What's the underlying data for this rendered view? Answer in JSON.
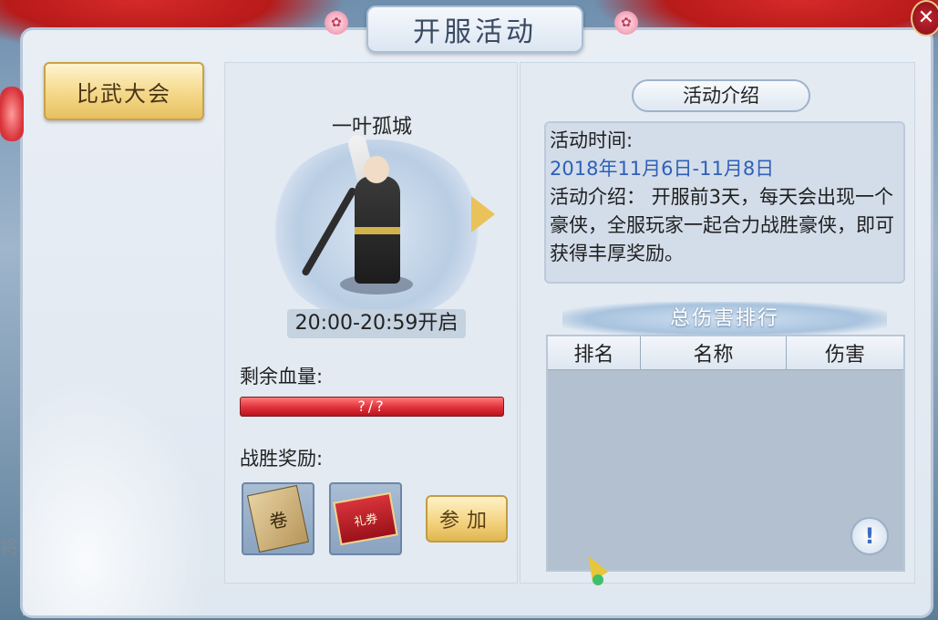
{
  "window": {
    "title": "开服活动",
    "close_icon": "close-icon"
  },
  "side": {
    "tab_label": "比武大会",
    "edge_text": "将"
  },
  "boss": {
    "name": "一叶孤城",
    "time": "20:00-20:59开启",
    "hp_label": "剩余血量:",
    "hp_value": "?/?",
    "reward_label": "战胜奖励:",
    "reward_items": [
      "scroll-item",
      "gift-ticket-item"
    ],
    "ticket_text": "礼券",
    "join_label": "参加"
  },
  "intro": {
    "header": "活动介绍",
    "time_label": "活动时间:",
    "date": "2018年11月6日-11月8日",
    "desc": "活动介绍： 开服前3天，每天会出现一个豪侠，全服玩家一起合力战胜豪侠，即可获得丰厚奖励。"
  },
  "ranking": {
    "title": "总伤害排行",
    "columns": [
      "排名",
      "名称",
      "伤害"
    ],
    "rows": [],
    "info_button": "!"
  },
  "colors": {
    "accent_gold": "#e9c25a",
    "hp_red": "#e0303a",
    "date_blue": "#2f5fb8",
    "drape_red": "#c01e1e"
  }
}
